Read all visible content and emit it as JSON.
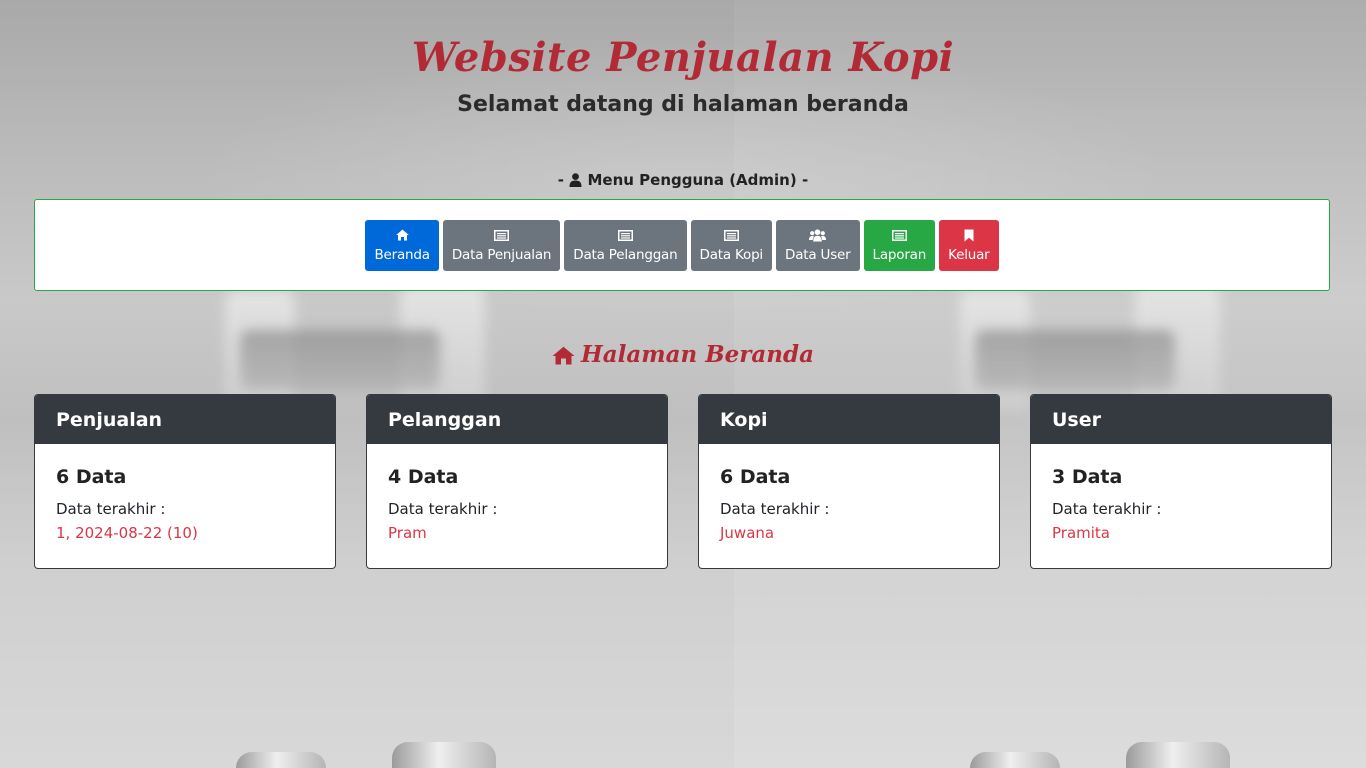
{
  "header": {
    "title": "Website Penjualan Kopi",
    "subtitle": "Selamat datang di halaman beranda"
  },
  "menu": {
    "heading_prefix": "-",
    "heading": "Menu Pengguna (Admin)",
    "heading_suffix": "-",
    "heading_icon": "user-icon",
    "border_color": "#28a745",
    "buttons": [
      {
        "label": "Beranda",
        "icon": "home-icon",
        "color": "#0069d9",
        "active": true
      },
      {
        "label": "Data Penjualan",
        "icon": "list-icon",
        "color": "#6c757d"
      },
      {
        "label": "Data Pelanggan",
        "icon": "list-icon",
        "color": "#6c757d"
      },
      {
        "label": "Data Kopi",
        "icon": "list-icon",
        "color": "#6c757d"
      },
      {
        "label": "Data User",
        "icon": "users-icon",
        "color": "#6c757d"
      },
      {
        "label": "Laporan",
        "icon": "list-icon",
        "color": "#28a745"
      },
      {
        "label": "Keluar",
        "icon": "bookmark-icon",
        "color": "#dc3545"
      }
    ]
  },
  "section": {
    "title": "Halaman Beranda",
    "icon": "home-icon",
    "color": "#b22a35"
  },
  "cards": [
    {
      "title": "Penjualan",
      "count": "6 Data",
      "label": "Data terakhir :",
      "value": "1, 2024-08-22 (10)"
    },
    {
      "title": "Pelanggan",
      "count": "4 Data",
      "label": "Data terakhir :",
      "value": "Pram"
    },
    {
      "title": "Kopi",
      "count": "6 Data",
      "label": "Data terakhir :",
      "value": "Juwana"
    },
    {
      "title": "User",
      "count": "3 Data",
      "label": "Data terakhir :",
      "value": "Pramita"
    }
  ],
  "colors": {
    "accent": "#b22a35",
    "card_header": "#343a40",
    "highlight_text": "#dc3545"
  }
}
